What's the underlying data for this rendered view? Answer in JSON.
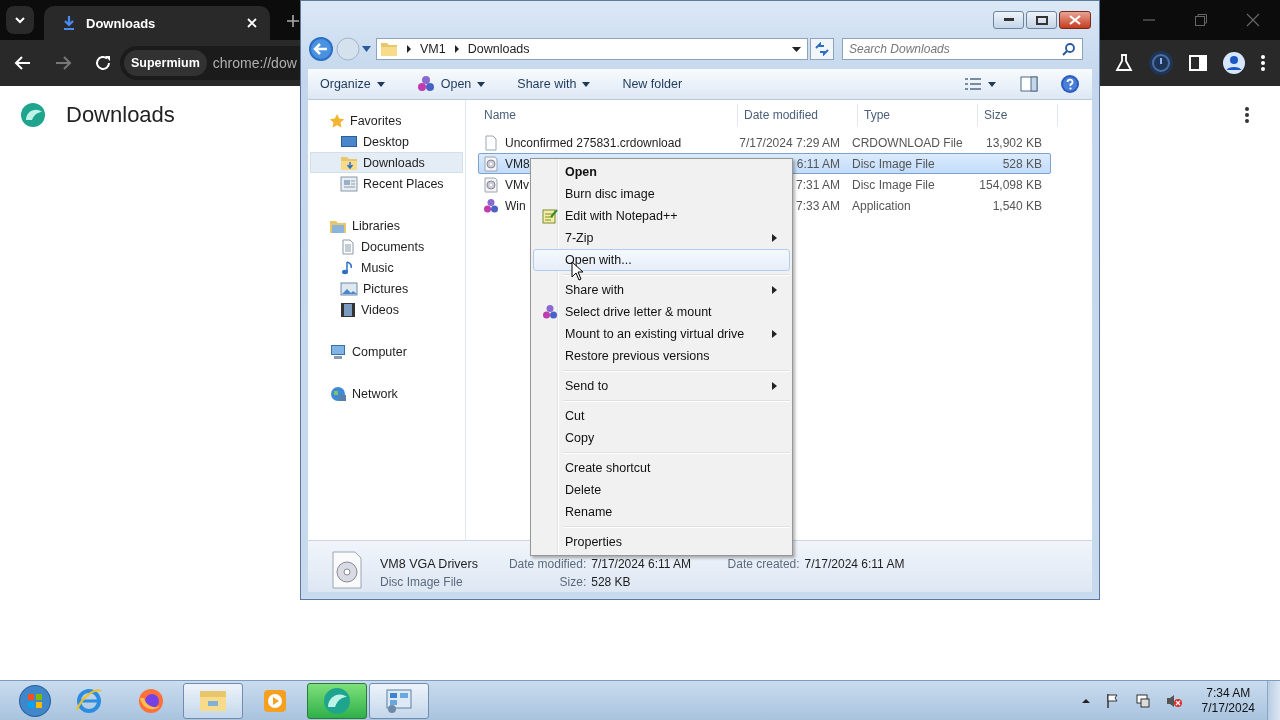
{
  "browser": {
    "tab_title": "Downloads",
    "omnibox_chip": "Supermium",
    "url": "chrome://dow",
    "page_title": "Downloads"
  },
  "explorer": {
    "breadcrumb": [
      "VM1",
      "Downloads"
    ],
    "search_placeholder": "Search Downloads",
    "commands": [
      {
        "label": "Organize",
        "dropdown": true
      },
      {
        "label": "Open",
        "dropdown": true
      },
      {
        "label": "Share with",
        "dropdown": true
      },
      {
        "label": "New folder",
        "dropdown": false
      }
    ],
    "nav": [
      {
        "label": "Favorites",
        "selected": false,
        "children": [
          {
            "label": "Desktop",
            "selected": false
          },
          {
            "label": "Downloads",
            "selected": true
          },
          {
            "label": "Recent Places",
            "selected": false
          }
        ]
      },
      {
        "label": "Libraries",
        "selected": false,
        "children": [
          {
            "label": "Documents",
            "selected": false
          },
          {
            "label": "Music",
            "selected": false
          },
          {
            "label": "Pictures",
            "selected": false
          },
          {
            "label": "Videos",
            "selected": false
          }
        ]
      },
      {
        "label": "Computer",
        "selected": false
      },
      {
        "label": "Network",
        "selected": false
      }
    ],
    "columns": [
      "Name",
      "Date modified",
      "Type",
      "Size"
    ],
    "rows": [
      {
        "name": "Unconfirmed 275831.crdownload",
        "date": "7/17/2024 7:29 AM",
        "type": "CRDOWNLOAD File",
        "size": "13,902 KB",
        "selected": false
      },
      {
        "name": "VM8",
        "date": "6:11 AM",
        "type": "Disc Image File",
        "size": "528 KB",
        "selected": true
      },
      {
        "name": "VMv",
        "date": "7:31 AM",
        "type": "Disc Image File",
        "size": "154,098 KB",
        "selected": false
      },
      {
        "name": "Win",
        "date": "7:33 AM",
        "type": "Application",
        "size": "1,540 KB",
        "selected": false
      }
    ],
    "details": {
      "name": "VM8 VGA Drivers",
      "type": "Disc Image File",
      "fields": [
        {
          "label": "Date modified:",
          "value": "7/17/2024 6:11 AM"
        },
        {
          "label": "Size:",
          "value": "528 KB"
        },
        {
          "label": "Date created:",
          "value": "7/17/2024 6:11 AM"
        }
      ]
    }
  },
  "context_menu": [
    {
      "kind": "item",
      "label": "Open",
      "default": true,
      "submenu": false,
      "highlighted": false
    },
    {
      "kind": "item",
      "label": "Burn disc image",
      "default": false,
      "submenu": false,
      "highlighted": false
    },
    {
      "kind": "item",
      "label": "Edit with Notepad++",
      "default": false,
      "submenu": false,
      "highlighted": false
    },
    {
      "kind": "item",
      "label": "7-Zip",
      "default": false,
      "submenu": true,
      "highlighted": false
    },
    {
      "kind": "item",
      "label": "Open with...",
      "default": false,
      "submenu": false,
      "highlighted": true
    },
    {
      "kind": "separator"
    },
    {
      "kind": "item",
      "label": "Share with",
      "default": false,
      "submenu": true,
      "highlighted": false
    },
    {
      "kind": "item",
      "label": "Select drive letter & mount",
      "default": false,
      "submenu": false,
      "highlighted": false
    },
    {
      "kind": "item",
      "label": "Mount to an existing virtual drive",
      "default": false,
      "submenu": true,
      "highlighted": false
    },
    {
      "kind": "item",
      "label": "Restore previous versions",
      "default": false,
      "submenu": false,
      "highlighted": false
    },
    {
      "kind": "separator"
    },
    {
      "kind": "item",
      "label": "Send to",
      "default": false,
      "submenu": true,
      "highlighted": false
    },
    {
      "kind": "separator"
    },
    {
      "kind": "item",
      "label": "Cut",
      "default": false,
      "submenu": false,
      "highlighted": false
    },
    {
      "kind": "item",
      "label": "Copy",
      "default": false,
      "submenu": false,
      "highlighted": false
    },
    {
      "kind": "separator"
    },
    {
      "kind": "item",
      "label": "Create shortcut",
      "default": false,
      "submenu": false,
      "highlighted": false
    },
    {
      "kind": "item",
      "label": "Delete",
      "default": false,
      "submenu": false,
      "highlighted": false
    },
    {
      "kind": "item",
      "label": "Rename",
      "default": false,
      "submenu": false,
      "highlighted": false
    },
    {
      "kind": "separator"
    },
    {
      "kind": "item",
      "label": "Properties",
      "default": false,
      "submenu": false,
      "highlighted": false
    }
  ],
  "taskbar": {
    "buttons": [
      {
        "open": false,
        "highlighted": false
      },
      {
        "open": false,
        "highlighted": false
      },
      {
        "open": true,
        "highlighted": false
      },
      {
        "open": false,
        "highlighted": false
      },
      {
        "open": true,
        "highlighted": true
      },
      {
        "open": true,
        "highlighted": false
      }
    ],
    "time": "7:34 AM",
    "date": "7/17/2024"
  }
}
